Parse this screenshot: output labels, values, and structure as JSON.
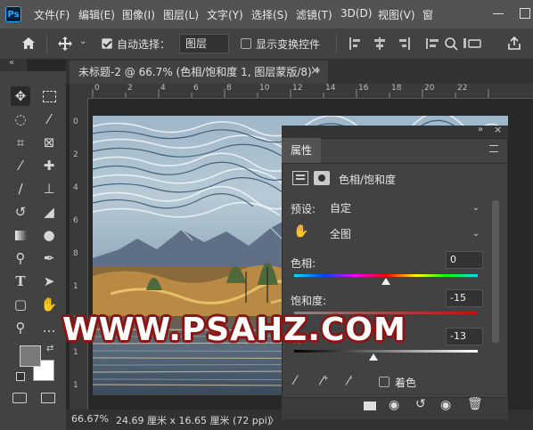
{
  "app": {
    "logo_text": "Ps"
  },
  "menu": [
    "文件(F)",
    "编辑(E)",
    "图像(I)",
    "图层(L)",
    "文字(Y)",
    "选择(S)",
    "滤镜(T)",
    "3D(D)",
    "视图(V)",
    "窗"
  ],
  "options": {
    "auto_select_label": "自动选择：",
    "layer_option": "图层",
    "show_transform_label": "显示变换控件"
  },
  "document": {
    "tab_title": "未标题-2 @ 66.7% (色相/饱和度 1, 图层蒙版/8) *",
    "close": "×"
  },
  "ruler": {
    "h": [
      "0",
      "2",
      "4",
      "6",
      "8",
      "10",
      "12",
      "14",
      "16",
      "18",
      "20",
      "22"
    ],
    "v": [
      "0",
      "2",
      "4",
      "6",
      "8",
      "1",
      "1",
      "1",
      "1",
      "1"
    ]
  },
  "status": {
    "zoom": "66.67%",
    "size": "24.69 厘米 x 16.65 厘米 (72 ppi)",
    "arrow": "〉"
  },
  "properties": {
    "tab": "属性",
    "title": "色相/饱和度",
    "preset_label": "预设:",
    "preset_value": "自定",
    "channel_value": "全图",
    "hue_label": "色相:",
    "hue_value": "0",
    "hue_level": 0.5,
    "saturation_label": "饱和度:",
    "saturation_value": "-15",
    "saturation_level": 0.46,
    "lightness_label": "明",
    "lightness_value": "-13",
    "lightness_level": 0.43,
    "colorize_label": "着色"
  },
  "watermark": {
    "text": "WWW.PSAHZ.COM"
  },
  "icons": [
    "home-icon",
    "move-icon",
    "marquee-icon",
    "lasso-icon",
    "magic-wand-icon",
    "crop-icon",
    "frame-icon",
    "eyedropper-icon",
    "healing-icon",
    "brush-icon",
    "stamp-icon",
    "history-brush-icon",
    "eraser-icon",
    "gradient-icon",
    "blur-icon",
    "dodge-icon",
    "pen-icon",
    "type-icon",
    "path-select-icon",
    "shape-icon",
    "hand-icon",
    "zoom-icon",
    "more-icon",
    "quick-mask-icon",
    "screen-mode-icon"
  ]
}
